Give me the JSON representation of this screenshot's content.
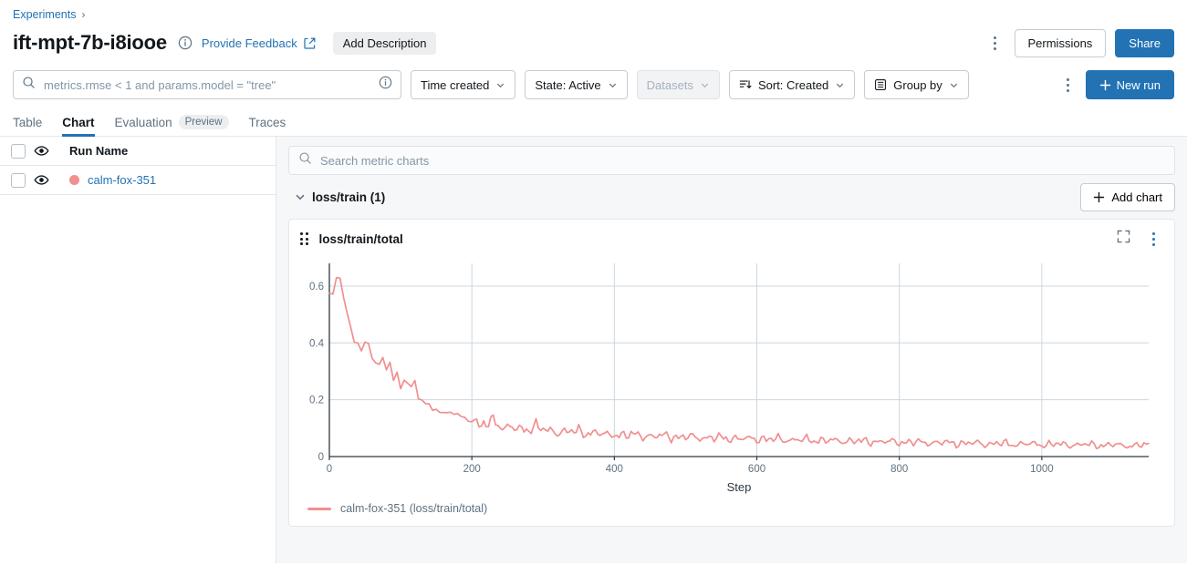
{
  "breadcrumb": {
    "root": "Experiments",
    "separator": "›"
  },
  "header": {
    "title": "ift-mpt-7b-i8iooe",
    "info_icon": "info-icon",
    "feedback_link": "Provide Feedback",
    "external_icon": "external-link-icon",
    "add_description": "Add Description",
    "permissions_button": "Permissions",
    "share_button": "Share",
    "overflow_icon": "kebab-menu-icon"
  },
  "toolbar": {
    "search_value": "metrics.rmse < 1 and params.model = \"tree\"",
    "search_icon": "search-icon",
    "search_info_icon": "info-icon",
    "time_created": "Time created",
    "state": "State: Active",
    "datasets": "Datasets",
    "sort": "Sort: Created",
    "group_by": "Group by",
    "overflow_icon": "kebab-menu-icon",
    "new_run": "New run"
  },
  "tabs": [
    {
      "label": "Table",
      "active": false,
      "badge": null
    },
    {
      "label": "Chart",
      "active": true,
      "badge": null
    },
    {
      "label": "Evaluation",
      "active": false,
      "badge": "Preview"
    },
    {
      "label": "Traces",
      "active": false,
      "badge": null
    }
  ],
  "runs_panel": {
    "column_header": "Run Name",
    "visibility_icon": "eye-icon",
    "rows": [
      {
        "name": "calm-fox-351",
        "color": "#f08f8f"
      }
    ]
  },
  "charts_panel": {
    "search_placeholder": "Search metric charts",
    "search_icon": "search-icon",
    "section_title": "loss/train (1)",
    "section_chevron": "chevron-down-icon",
    "add_chart": "Add chart",
    "card_title": "loss/train/total",
    "drag_handle_icon": "drag-handle-icon",
    "fullscreen_icon": "fullscreen-icon",
    "card_menu_icon": "kebab-menu-icon"
  },
  "colors": {
    "accent": "#2272b4",
    "series": "#f08f8f",
    "grid": "#ccd7e0",
    "axis": "#2e3840",
    "panel_bg": "#f5f7f9"
  },
  "chart_data": {
    "type": "line",
    "title": "loss/train/total",
    "xlabel": "Step",
    "ylabel": "",
    "xlim": [
      0,
      1150
    ],
    "ylim": [
      0,
      0.68
    ],
    "xticks": [
      0,
      200,
      400,
      600,
      800,
      1000
    ],
    "yticks": [
      0,
      0.2,
      0.4,
      0.6
    ],
    "grid": true,
    "legend_position": "bottom-left",
    "series": [
      {
        "name": "calm-fox-351 (loss/train/total)",
        "legend_label": "calm-fox-351 (loss/train/total)",
        "color": "#f08f8f",
        "x": [
          0,
          5,
          10,
          15,
          20,
          25,
          30,
          35,
          40,
          45,
          50,
          55,
          60,
          65,
          70,
          75,
          80,
          85,
          90,
          95,
          100,
          105,
          110,
          115,
          120,
          125,
          130,
          135,
          140,
          145,
          150,
          155,
          160,
          165,
          170,
          175,
          180,
          185,
          190,
          195,
          200,
          210,
          220,
          230,
          240,
          250,
          260,
          270,
          280,
          290,
          300,
          310,
          320,
          330,
          340,
          350,
          360,
          370,
          380,
          390,
          400,
          410,
          420,
          430,
          440,
          450,
          460,
          470,
          480,
          490,
          500,
          510,
          520,
          530,
          540,
          550,
          560,
          570,
          580,
          590,
          600,
          610,
          620,
          630,
          640,
          650,
          660,
          670,
          680,
          690,
          700,
          710,
          720,
          730,
          740,
          750,
          760,
          770,
          780,
          790,
          800,
          810,
          820,
          830,
          840,
          850,
          860,
          870,
          880,
          890,
          900,
          910,
          920,
          930,
          940,
          950,
          960,
          970,
          980,
          990,
          1000,
          1010,
          1020,
          1030,
          1040,
          1050,
          1060,
          1070,
          1080,
          1090,
          1100,
          1110,
          1120,
          1130,
          1140,
          1150
        ],
        "y": [
          0.575,
          0.572,
          0.63,
          0.628,
          0.56,
          0.505,
          0.455,
          0.402,
          0.4,
          0.372,
          0.403,
          0.398,
          0.345,
          0.322,
          0.318,
          0.34,
          0.305,
          0.33,
          0.278,
          0.3,
          0.252,
          0.268,
          0.265,
          0.236,
          0.268,
          0.188,
          0.2,
          0.175,
          0.195,
          0.16,
          0.182,
          0.155,
          0.168,
          0.148,
          0.16,
          0.135,
          0.15,
          0.128,
          0.14,
          0.12,
          0.132,
          0.115,
          0.108,
          0.14,
          0.092,
          0.112,
          0.095,
          0.105,
          0.082,
          0.118,
          0.09,
          0.1,
          0.072,
          0.096,
          0.084,
          0.1,
          0.068,
          0.092,
          0.076,
          0.086,
          0.066,
          0.082,
          0.07,
          0.09,
          0.06,
          0.078,
          0.066,
          0.086,
          0.058,
          0.074,
          0.064,
          0.08,
          0.055,
          0.072,
          0.06,
          0.078,
          0.052,
          0.07,
          0.058,
          0.074,
          0.05,
          0.068,
          0.056,
          0.072,
          0.048,
          0.064,
          0.054,
          0.07,
          0.046,
          0.062,
          0.052,
          0.066,
          0.044,
          0.06,
          0.05,
          0.064,
          0.042,
          0.058,
          0.048,
          0.062,
          0.04,
          0.056,
          0.046,
          0.06,
          0.038,
          0.054,
          0.045,
          0.058,
          0.036,
          0.052,
          0.044,
          0.056,
          0.034,
          0.05,
          0.043,
          0.054,
          0.033,
          0.049,
          0.042,
          0.052,
          0.032,
          0.048,
          0.041,
          0.05,
          0.031,
          0.046,
          0.04,
          0.049,
          0.03,
          0.045,
          0.039,
          0.047,
          0.029,
          0.044,
          0.038,
          0.046
        ]
      }
    ]
  }
}
